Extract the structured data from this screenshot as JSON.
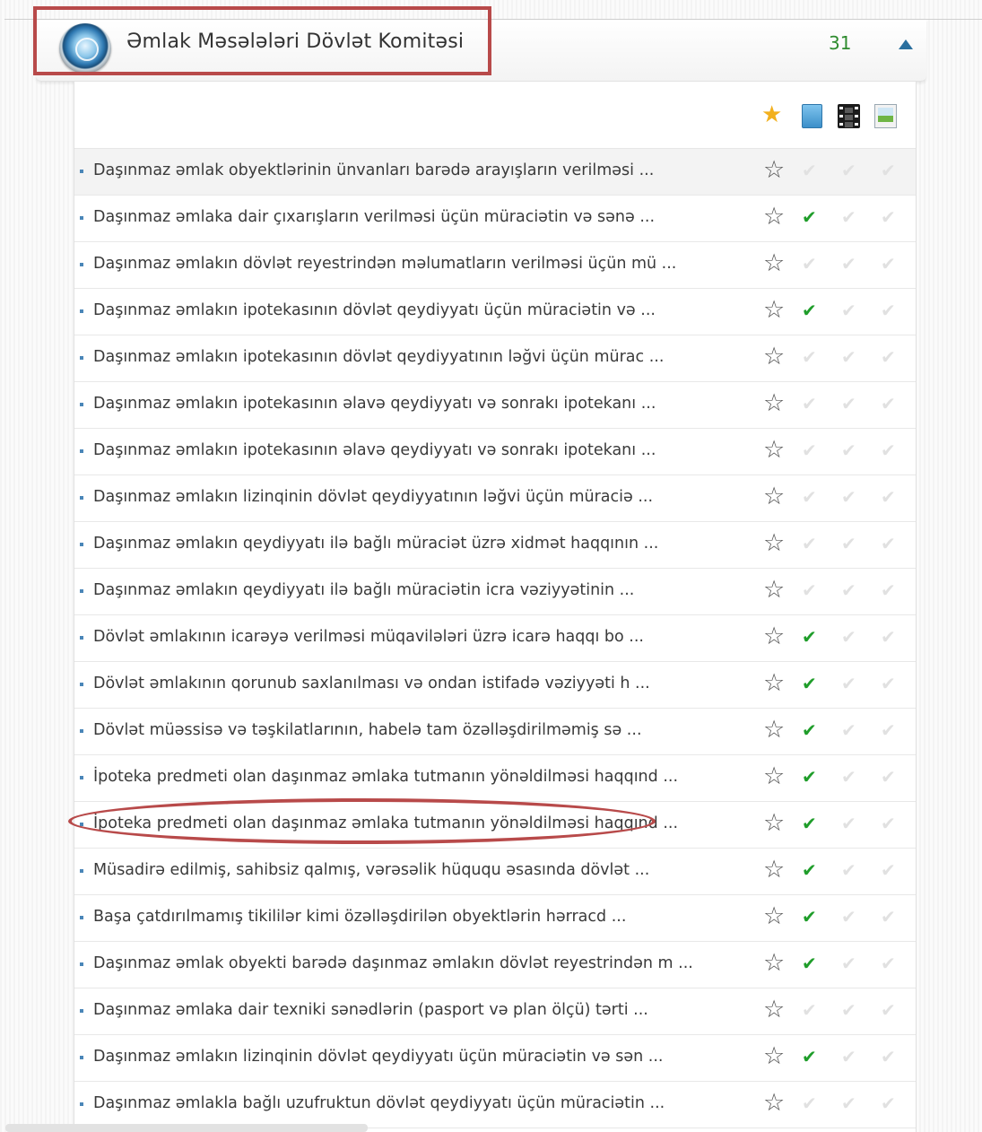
{
  "header": {
    "title": "Əmlak Məsələləri Dövlət Komitəsi",
    "count": "31",
    "logo_icon": "committee-emblem-icon",
    "collapse_icon": "triangle-up-icon"
  },
  "legend": {
    "icons": [
      "star-icon",
      "document-icon",
      "film-icon",
      "image-icon"
    ]
  },
  "colors": {
    "accent": "#2a6f9e",
    "count": "#2e8b2e",
    "check_active": "#1f9d2a",
    "check_inactive": "#e1e1e1",
    "highlight": "#b84a4a"
  },
  "glyphs": {
    "star": "☆",
    "check": "✔"
  },
  "services": [
    {
      "text": "Daşınmaz əmlak obyektlərinin ünvanları barədə arayışların verilməsi ...",
      "checks": [
        false,
        false,
        false
      ]
    },
    {
      "text": "Daşınmaz əmlaka dair çıxarışların verilməsi üçün müraciətin və sənə ...",
      "checks": [
        true,
        false,
        false
      ]
    },
    {
      "text": "Daşınmaz əmlakın dövlət reyestrindən məlumatların verilməsi üçün mü ...",
      "checks": [
        false,
        false,
        false
      ]
    },
    {
      "text": "Daşınmaz əmlakın ipotekasının dövlət qeydiyyatı üçün müraciətin və ...",
      "checks": [
        true,
        false,
        false
      ]
    },
    {
      "text": "Daşınmaz əmlakın ipotekasının dövlət qeydiyyatının ləğvi üçün mürac ...",
      "checks": [
        false,
        false,
        false
      ]
    },
    {
      "text": "Daşınmaz əmlakın ipotekasının əlavə qeydiyyatı və sonrakı ipotekanı ...",
      "checks": [
        false,
        false,
        false
      ]
    },
    {
      "text": "Daşınmaz əmlakın ipotekasının əlavə qeydiyyatı və sonrakı ipotekanı ...",
      "checks": [
        false,
        false,
        false
      ]
    },
    {
      "text": "Daşınmaz əmlakın lizinqinin dövlət qeydiyyatının ləğvi üçün müraciə ...",
      "checks": [
        false,
        false,
        false
      ]
    },
    {
      "text": "Daşınmaz əmlakın qeydiyyatı ilə bağlı müraciət üzrə xidmət haqqının ...",
      "checks": [
        false,
        false,
        false
      ]
    },
    {
      "text": "Daşınmaz əmlakın qeydiyyatı ilə bağlı müraciətin icra vəziyyətinin ...",
      "checks": [
        false,
        false,
        false
      ]
    },
    {
      "text": "Dövlət əmlakının icarəyə verilməsi müqavilələri üzrə icarə haqqı bo ...",
      "checks": [
        true,
        false,
        false
      ]
    },
    {
      "text": "Dövlət əmlakının qorunub saxlanılması və ondan istifadə vəziyyəti h ...",
      "checks": [
        true,
        false,
        false
      ]
    },
    {
      "text": "Dövlət müəssisə və təşkilatlarının, habelə tam özəlləşdirilməmiş sə ...",
      "checks": [
        true,
        false,
        false
      ]
    },
    {
      "text": "İpoteka predmeti olan daşınmaz əmlaka tutmanın yönəldilməsi haqqınd ...",
      "checks": [
        true,
        false,
        false
      ]
    },
    {
      "text": "İpoteka predmeti olan daşınmaz əmlaka tutmanın yönəldilməsi haqqınd ...",
      "checks": [
        true,
        false,
        false
      ]
    },
    {
      "text": "Müsadirə edilmiş, sahibsiz qalmış, vərəsəlik hüququ əsasında dövlət ...",
      "checks": [
        true,
        false,
        false
      ]
    },
    {
      "text": "Başa çatdırılmamış tikililər kimi özəlləşdirilən obyektlərin hərracd ...",
      "checks": [
        true,
        false,
        false
      ]
    },
    {
      "text": "Daşınmaz əmlak obyekti barədə daşınmaz əmlakın dövlət reyestrindən m ...",
      "checks": [
        true,
        false,
        false
      ]
    },
    {
      "text": "Daşınmaz əmlaka dair texniki sənədlərin (pasport və plan ölçü) tərti ...",
      "checks": [
        false,
        false,
        false
      ]
    },
    {
      "text": "Daşınmaz əmlakın lizinqinin dövlət qeydiyyatı üçün müraciətin və sən ...",
      "checks": [
        true,
        false,
        false
      ]
    },
    {
      "text": "Daşınmaz əmlakla bağlı uzufruktun dövlət qeydiyyatı üçün müraciətin ...",
      "checks": [
        false,
        false,
        false
      ]
    }
  ]
}
